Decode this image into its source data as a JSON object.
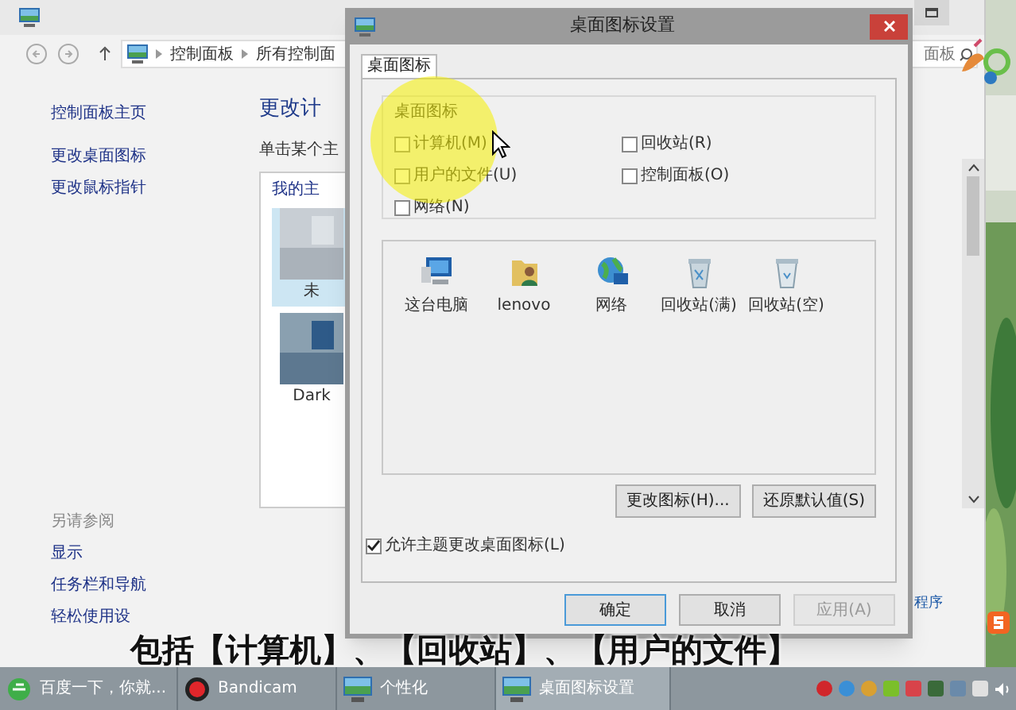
{
  "background_window": {
    "address": [
      "控制面板",
      "所有控制面"
    ],
    "search_field": "面板",
    "sidebar_links": [
      "控制面板主页",
      "更改桌面图标",
      "更改鼠标指针"
    ],
    "heading": "更改计",
    "hint": "单击某个主",
    "theme_group": "我的主",
    "themes": [
      {
        "label": "未",
        "selected": true
      },
      {
        "label": "Dark",
        "selected": false
      }
    ],
    "see_also_title": "另请参阅",
    "see_also_links": [
      "显示",
      "任务栏和导航",
      "轻松使用设"
    ],
    "link_partial": "程序"
  },
  "dialog": {
    "title": "桌面图标设置",
    "tabs": [
      {
        "label": "桌面图标",
        "selected": true
      }
    ],
    "group_title": "桌面图标",
    "checkboxes": [
      {
        "label": "计算机(M)",
        "checked": false
      },
      {
        "label": "回收站(R)",
        "checked": false
      },
      {
        "label": "用户的文件(U)",
        "checked": false
      },
      {
        "label": "控制面板(O)",
        "checked": false
      },
      {
        "label": "网络(N)",
        "checked": false
      }
    ],
    "icons": [
      {
        "label": "这台电脑",
        "kind": "computer"
      },
      {
        "label": "lenovo",
        "kind": "user"
      },
      {
        "label": "网络",
        "kind": "network"
      },
      {
        "label": "回收站(满)",
        "kind": "bin-full"
      },
      {
        "label": "回收站(空)",
        "kind": "bin-empty"
      }
    ],
    "buttons": [
      "更改图标(H)...",
      "还原默认值(S)"
    ],
    "allow_theme": {
      "label": "允许主题更改桌面图标(L)",
      "checked": true
    },
    "footer_buttons": [
      {
        "label": "确定",
        "disabled": false
      },
      {
        "label": "取消",
        "disabled": false
      },
      {
        "label": "应用(A)",
        "disabled": true
      }
    ]
  },
  "subtitle": "包括【计算机】、【回收站】、【用户的文件】",
  "taskbar": {
    "items": [
      {
        "label": "百度一下，你就...",
        "kind": "browser",
        "selected": false
      },
      {
        "label": "Bandicam",
        "kind": "record",
        "selected": false
      },
      {
        "label": "个性化",
        "kind": "window",
        "selected": false
      },
      {
        "label": "桌面图标设置",
        "kind": "window",
        "selected": true
      }
    ]
  }
}
